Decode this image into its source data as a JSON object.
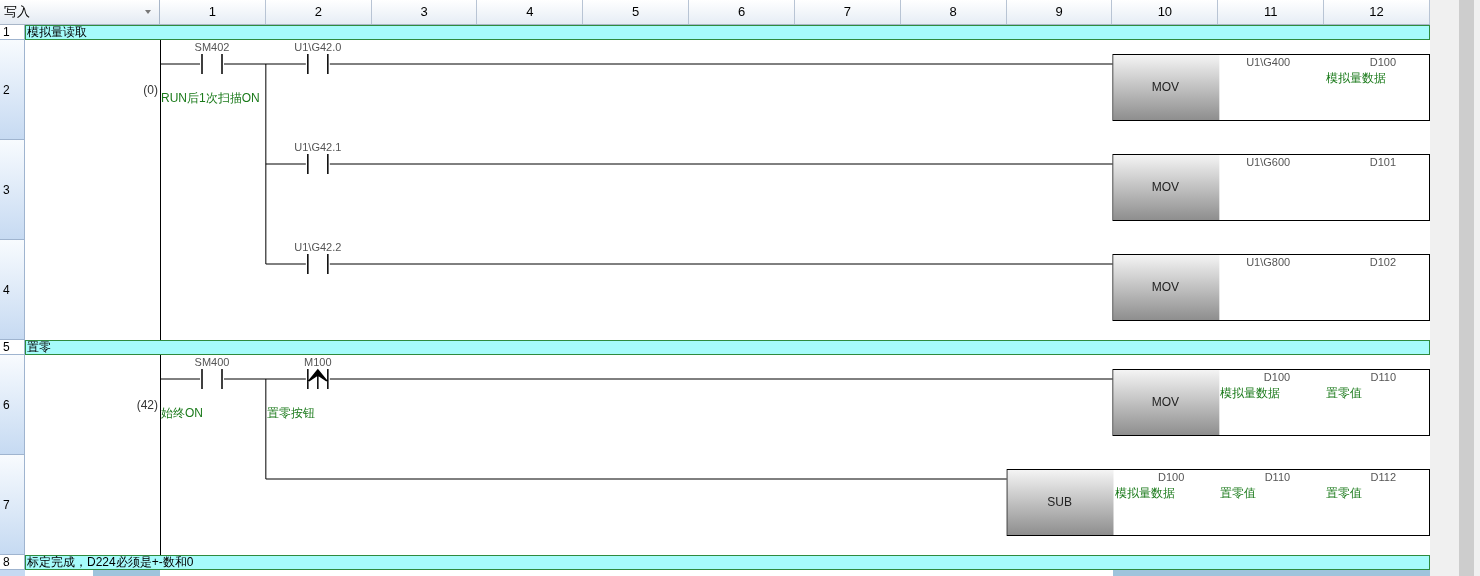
{
  "editor": {
    "mode_label": "写入",
    "columns": [
      "1",
      "2",
      "3",
      "4",
      "5",
      "6",
      "7",
      "8",
      "9",
      "10",
      "11",
      "12"
    ]
  },
  "rows": [
    {
      "kind": "comment",
      "number": "1",
      "text": "模拟量读取"
    },
    {
      "kind": "rung",
      "numbers": [
        "2",
        "3",
        "4"
      ],
      "step": "(0)",
      "lines": [
        {
          "contacts": [
            {
              "kind": "normally_open",
              "device": "SM402",
              "comment": "RUN后1次扫描ON"
            },
            {
              "kind": "normally_open",
              "device": "U1\\G42.0"
            }
          ],
          "instruction": {
            "op": "MOV",
            "operands": [
              {
                "device": "U1\\G400"
              },
              {
                "device": "D100",
                "comment": "模拟量数据"
              }
            ]
          }
        },
        {
          "contacts": [
            {
              "kind": "normally_open",
              "device": "U1\\G42.1"
            }
          ],
          "instruction": {
            "op": "MOV",
            "operands": [
              {
                "device": "U1\\G600"
              },
              {
                "device": "D101"
              }
            ]
          }
        },
        {
          "contacts": [
            {
              "kind": "normally_open",
              "device": "U1\\G42.2"
            }
          ],
          "instruction": {
            "op": "MOV",
            "operands": [
              {
                "device": "U1\\G800"
              },
              {
                "device": "D102"
              }
            ]
          }
        }
      ]
    },
    {
      "kind": "comment",
      "number": "5",
      "text": "置零"
    },
    {
      "kind": "rung",
      "numbers": [
        "6",
        "7"
      ],
      "step": "(42)",
      "lines": [
        {
          "contacts": [
            {
              "kind": "normally_open",
              "device": "SM400",
              "comment": "始终ON"
            },
            {
              "kind": "rising_edge",
              "device": "M100",
              "comment": "置零按钮"
            }
          ],
          "instruction": {
            "op": "MOV",
            "operands": [
              {
                "device": "D100",
                "comment": "模拟量数据"
              },
              {
                "device": "D110",
                "comment": "置零值"
              }
            ]
          }
        },
        {
          "instruction": {
            "op": "SUB",
            "operands": [
              {
                "device": "D100",
                "comment": "模拟量数据"
              },
              {
                "device": "D110",
                "comment": "置零值"
              },
              {
                "device": "D112",
                "comment": "置零值"
              }
            ]
          }
        }
      ]
    },
    {
      "kind": "comment",
      "number": "8",
      "text": "标定完成，D224必须是+-数和0"
    }
  ]
}
